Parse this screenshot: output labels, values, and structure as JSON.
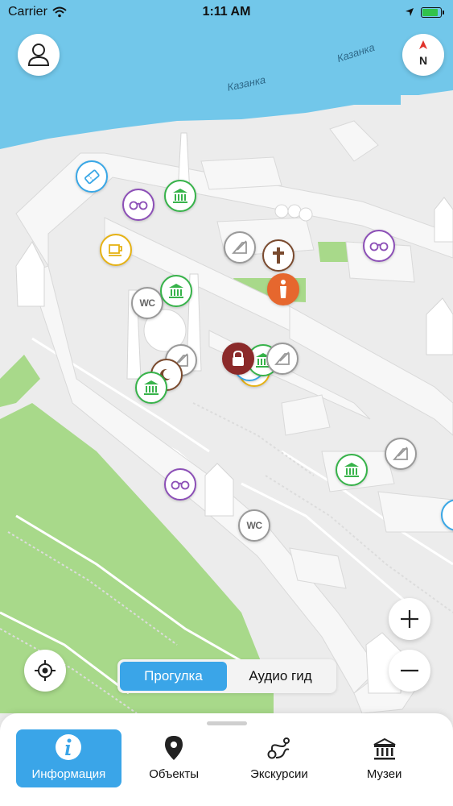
{
  "status_bar": {
    "carrier": "Carrier",
    "time": "1:11 AM",
    "battery_level": 0.85
  },
  "map": {
    "labels": [
      "Казанка",
      "Казанка"
    ],
    "colors": {
      "water": "#72c7ea",
      "ground": "#ececec",
      "park": "#a8d98a",
      "building": "#ffffff"
    }
  },
  "compass": {
    "label": "N"
  },
  "mode_switch": {
    "options": [
      "Прогулка",
      "Аудио гид"
    ],
    "selected": "Прогулка"
  },
  "bottom_tabs": [
    {
      "label": "Информация",
      "icon": "info-icon",
      "active": true
    },
    {
      "label": "Объекты",
      "icon": "location-pin-icon",
      "active": false
    },
    {
      "label": "Экскурсии",
      "icon": "route-icon",
      "active": false
    },
    {
      "label": "Музеи",
      "icon": "museum-icon",
      "active": false
    }
  ],
  "poi_wc_label": "WC",
  "accent_color": "#3aa5e8"
}
